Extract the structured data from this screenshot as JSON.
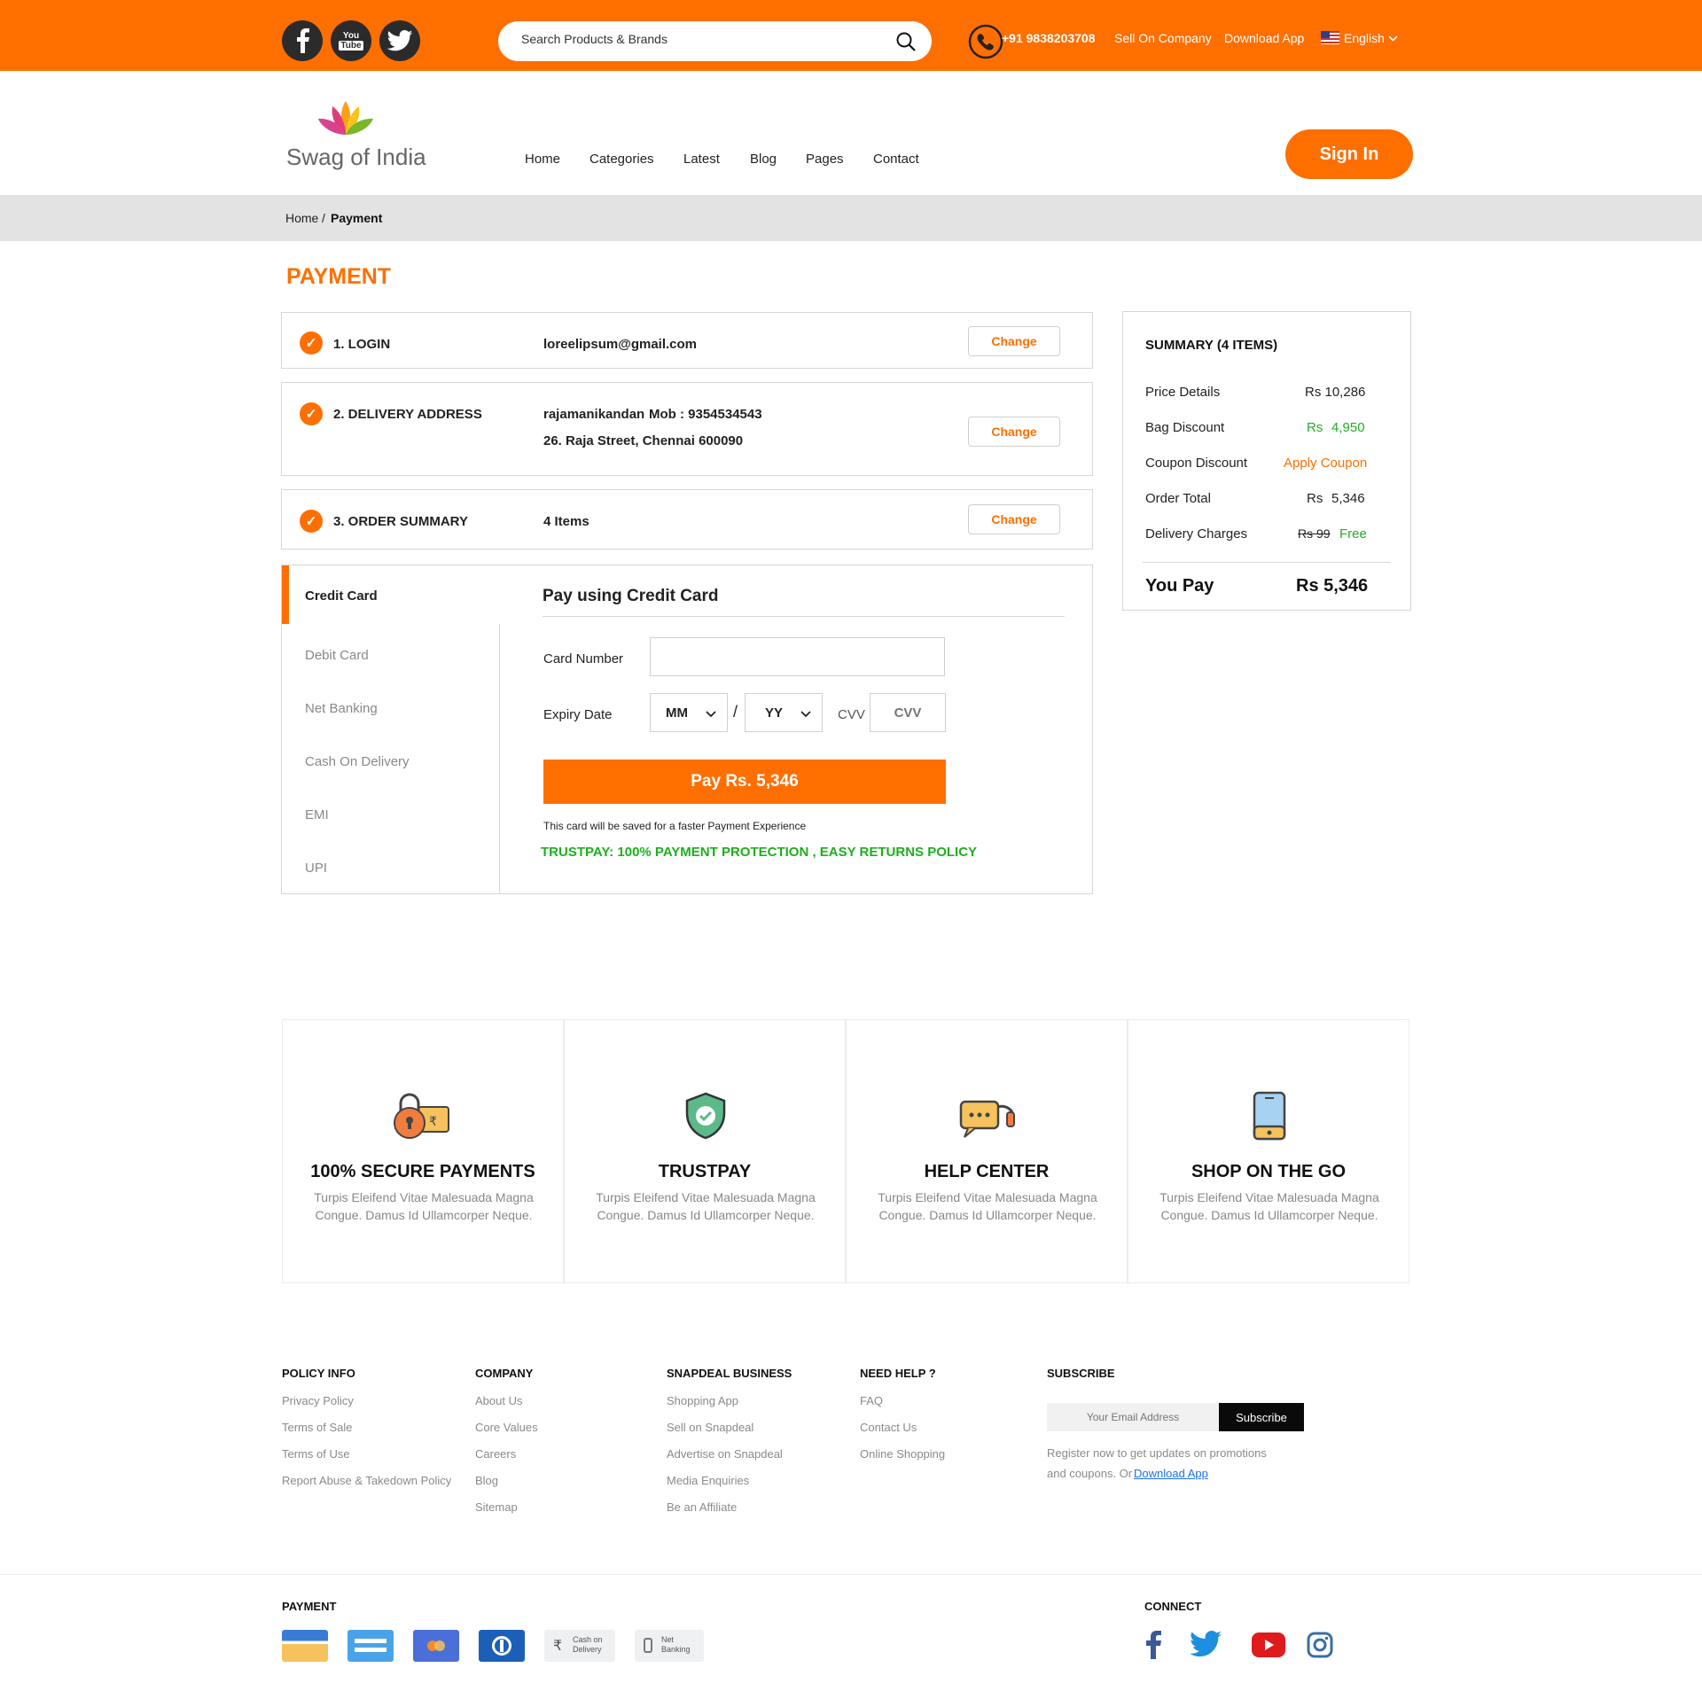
{
  "topbar": {
    "search_placeholder": "Search Products & Brands",
    "phone": "+91 9838203708",
    "sell_link": "Sell On Company",
    "download_link": "Download App",
    "language": "English",
    "social": [
      "facebook-icon",
      "youtube-icon",
      "twitter-icon"
    ],
    "youtube_text_1": "You",
    "youtube_text_2": "Tube"
  },
  "brand": {
    "name": "Swag of India"
  },
  "nav": {
    "items": [
      "Home",
      "Categories",
      "Latest",
      "Blog",
      "Pages",
      "Contact"
    ],
    "signin": "Sign In"
  },
  "breadcrumb": {
    "home": "Home",
    "separator": "/",
    "current": "Payment"
  },
  "page": {
    "title": "PAYMENT"
  },
  "steps": [
    {
      "label": "1. LOGIN",
      "value": "loreelipsum@gmail.com",
      "change": "Change"
    },
    {
      "label": "2. DELIVERY ADDRESS",
      "name": "rajamanikandan",
      "mobile": "Mob : 9354534543",
      "address": "26. Raja Street, Chennai 600090",
      "change": "Change"
    },
    {
      "label": "3. ORDER SUMMARY",
      "value": "4 Items",
      "change": "Change"
    }
  ],
  "payment": {
    "tabs": [
      "Credit Card",
      "Debit Card",
      "Net Banking",
      "Cash On Delivery",
      "EMI",
      "UPI"
    ],
    "active_tab": "Credit Card",
    "heading": "Pay using Credit Card",
    "card_number_label": "Card Number",
    "card_number_value": "",
    "expiry_label": "Expiry Date",
    "month": "MM",
    "slash": "/",
    "year": "YY",
    "cvv_label": "CVV",
    "cvv_placeholder": "CVV",
    "pay_button": "Pay Rs. 5,346",
    "save_note": "This card will be saved for a faster Payment Experience",
    "trust_note": "TRUSTPAY: 100% PAYMENT PROTECTION , EASY RETURNS POLICY"
  },
  "summary": {
    "title": "SUMMARY (4 ITEMS)",
    "price_details_label": "Price Details",
    "price_details_value": "Rs 10,286",
    "bag_discount_label": "Bag Discount",
    "bag_discount_currency": "Rs",
    "bag_discount_value": "4,950",
    "coupon_label": "Coupon Discount",
    "coupon_action": "Apply Coupon",
    "order_total_label": "Order Total",
    "order_total_currency": "Rs",
    "order_total_value": "5,346",
    "delivery_label": "Delivery Charges",
    "delivery_old": "Rs 99",
    "delivery_value": "Free",
    "you_pay_label": "You Pay",
    "you_pay_value": "Rs 5,346"
  },
  "features": [
    {
      "title": "100% SECURE PAYMENTS",
      "text": "Turpis Eleifend Vitae Malesuada Magna Congue. Damus Id Ullamcorper Neque."
    },
    {
      "title": "TRUSTPAY",
      "text": "Turpis Eleifend Vitae Malesuada Magna Congue. Damus Id Ullamcorper Neque."
    },
    {
      "title": "HELP CENTER",
      "text": "Turpis Eleifend Vitae Malesuada Magna Congue. Damus Id Ullamcorper Neque."
    },
    {
      "title": "SHOP ON THE GO",
      "text": "Turpis Eleifend Vitae Malesuada Magna Congue. Damus Id Ullamcorper Neque."
    }
  ],
  "footer": {
    "policy": {
      "title": "POLICY INFO",
      "links": [
        "Privacy Policy",
        "Terms of Sale",
        "Terms of Use",
        "Report Abuse & Takedown Policy"
      ]
    },
    "company": {
      "title": "COMPANY",
      "links": [
        "About Us",
        "Core Values",
        "Careers",
        "Blog",
        "Sitemap"
      ]
    },
    "business": {
      "title": "SNAPDEAL BUSINESS",
      "links": [
        "Shopping App",
        "Sell on Snapdeal",
        "Advertise on Snapdeal",
        "Media Enquiries",
        "Be an Affiliate"
      ]
    },
    "help": {
      "title": "NEED HELP ?",
      "links": [
        "FAQ",
        "Contact Us",
        "Online Shopping"
      ]
    },
    "subscribe": {
      "title": "SUBSCRIBE",
      "placeholder": "Your Email Address",
      "button": "Subscribe",
      "note": "Register now to get updates on promotions",
      "note2": "and coupons. Or",
      "link": "Download App"
    },
    "payment_title": "PAYMENT",
    "payment_icons": [
      "visa-card-icon",
      "generic-card-icon",
      "mastercard-icon",
      "diners-card-icon",
      "cash-on-delivery-icon",
      "net-banking-icon"
    ],
    "cod_line1": "Cash on",
    "cod_line2": "Delivery",
    "netbank_line1": "Net",
    "netbank_line2": "Banking",
    "connect_title": "CONNECT",
    "connect_icons": [
      "facebook-icon",
      "twitter-icon",
      "youtube-icon",
      "instagram-icon"
    ]
  }
}
